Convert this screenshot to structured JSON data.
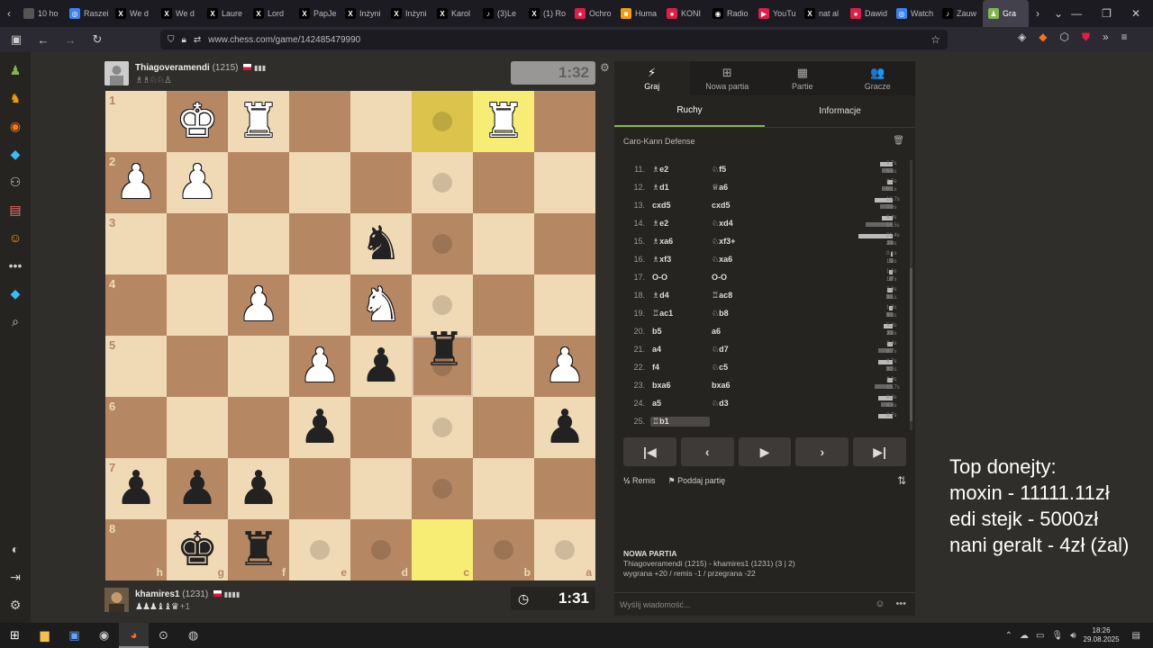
{
  "browser": {
    "tabs": [
      {
        "label": "10 ho",
        "fav": "",
        "color": "#555"
      },
      {
        "label": "Raszei",
        "fav": "◎",
        "color": "#3b82f6"
      },
      {
        "label": "We d",
        "fav": "X",
        "color": "#000"
      },
      {
        "label": "We d",
        "fav": "X",
        "color": "#000"
      },
      {
        "label": "Laure",
        "fav": "X",
        "color": "#000"
      },
      {
        "label": "Lord",
        "fav": "X",
        "color": "#000"
      },
      {
        "label": "PapJe",
        "fav": "X",
        "color": "#000"
      },
      {
        "label": "Inżyni",
        "fav": "X",
        "color": "#000"
      },
      {
        "label": "Inżyni",
        "fav": "X",
        "color": "#000"
      },
      {
        "label": "Karol",
        "fav": "X",
        "color": "#000"
      },
      {
        "label": "(3)Le",
        "fav": "♪",
        "color": "#000"
      },
      {
        "label": "(1) Ro",
        "fav": "X",
        "color": "#000"
      },
      {
        "label": "Ochro",
        "fav": "●",
        "color": "#e11d48"
      },
      {
        "label": "Huma",
        "fav": "■",
        "color": "#f59e0b"
      },
      {
        "label": "KONI",
        "fav": "●",
        "color": "#e11d48"
      },
      {
        "label": "Radio",
        "fav": "◉",
        "color": "#000"
      },
      {
        "label": "YouTu",
        "fav": "▶",
        "color": "#e11d48"
      },
      {
        "label": "nat al",
        "fav": "X",
        "color": "#000"
      },
      {
        "label": "Dawid",
        "fav": "●",
        "color": "#e11d48"
      },
      {
        "label": "Watch",
        "fav": "◎",
        "color": "#3b82f6"
      },
      {
        "label": "Zauw",
        "fav": "♪",
        "color": "#000"
      },
      {
        "label": "Gra",
        "fav": "♟",
        "color": "#81b64c",
        "active": true
      }
    ],
    "url": "www.chess.com/game/142485479990"
  },
  "top_player": {
    "name": "Thiagoveramendi",
    "rating": "(1215)",
    "captured": "♗♗♘♘♙",
    "clock": "1:32"
  },
  "bottom_player": {
    "name": "khamires1",
    "rating": "(1231)",
    "captured": "♟♟♟♝♝♛",
    "extra": "+1",
    "clock": "1:31"
  },
  "panel": {
    "tabs": [
      {
        "label": "Graj",
        "icon": "⚡",
        "active": true
      },
      {
        "label": "Nowa partia",
        "icon": "⊞"
      },
      {
        "label": "Partie",
        "icon": "▦"
      },
      {
        "label": "Gracze",
        "icon": "👥"
      }
    ],
    "subtabs": [
      {
        "label": "Ruchy",
        "active": true
      },
      {
        "label": "Informacje"
      }
    ],
    "opening": "Caro-Kann Defense",
    "moves": [
      {
        "n": "11.",
        "w": "♗e2",
        "b": "♘f5",
        "tw": "6.7s",
        "tb": "5.6s",
        "bw": 14,
        "bb": 12
      },
      {
        "n": "12.",
        "w": "♗d1",
        "b": "♕a6",
        "tw": "2.5s",
        "tb": "6.1s",
        "bw": 6,
        "bb": 12
      },
      {
        "n": "13.",
        "w": "cxd5",
        "b": "cxd5",
        "tw": "10.7s",
        "tb": "7.0s",
        "bw": 20,
        "bb": 14
      },
      {
        "n": "14.",
        "w": "♗e2",
        "b": "♘xd4",
        "tw": "6.4s",
        "tb": "16.5s",
        "bw": 12,
        "bb": 30
      },
      {
        "n": "15.",
        "w": "♗xa6",
        "b": "♘xf3+",
        "tw": "21.4s",
        "tb": "2.4s",
        "bw": 38,
        "bb": 6
      },
      {
        "n": "16.",
        "w": "♗xf3",
        "b": "♘xa6",
        "tw": "0.1s",
        "tb": "1.3s",
        "bw": 2,
        "bb": 4
      },
      {
        "n": "17.",
        "w": "O-O",
        "b": "O-O",
        "tw": "1.6s",
        "tb": "1.7s",
        "bw": 4,
        "bb": 4
      },
      {
        "n": "18.",
        "w": "♗d4",
        "b": "♖ac8",
        "tw": "2.9s",
        "tb": "3.1s",
        "bw": 6,
        "bb": 7
      },
      {
        "n": "19.",
        "w": "♖ac1",
        "b": "♘b8",
        "tw": "1.3s",
        "tb": "3.3s",
        "bw": 4,
        "bb": 7
      },
      {
        "n": "20.",
        "w": "b5",
        "b": "a6",
        "tw": "5.3s",
        "tb": "2.3s",
        "bw": 10,
        "bb": 6
      },
      {
        "n": "21.",
        "w": "a4",
        "b": "♘d7",
        "tw": "2.4s",
        "tb": "8.7s",
        "bw": 6,
        "bb": 16
      },
      {
        "n": "22.",
        "w": "f4",
        "b": "♘c5",
        "tw": "8.7s",
        "tb": "3.2s",
        "bw": 16,
        "bb": 7
      },
      {
        "n": "23.",
        "w": "bxa6",
        "b": "bxa6",
        "tw": "2.9s",
        "tb": "10.7s",
        "bw": 6,
        "bb": 20
      },
      {
        "n": "24.",
        "w": "a5",
        "b": "♘d3",
        "tw": "8.3s",
        "tb": "6.8s",
        "bw": 16,
        "bb": 13
      },
      {
        "n": "25.",
        "w": "♖b1",
        "b": "",
        "tw": "8.7s",
        "tb": "",
        "bw": 16,
        "bb": 0,
        "current": true
      }
    ],
    "actions": {
      "draw": "Remis",
      "resign": "Poddaj partię"
    },
    "game_info": {
      "title": "NOWA PARTIA",
      "players": "Thiagoveramendi (1215) - khamires1 (1231) (3 | 2)",
      "result": "wygrana +20 / remis -1 / przegrana -22"
    },
    "chat_placeholder": "Wyślij wiadomość..."
  },
  "donors": {
    "title": "Top donejty:",
    "lines": [
      "moxin - 11111.11zł",
      "edi stejk - 5000zł",
      "nani geralt - 4zł (żal)"
    ]
  },
  "taskbar": {
    "time": "18:26",
    "date": "29.08.2025"
  },
  "board": {
    "orientation": "black-bottom",
    "files": [
      "h",
      "g",
      "f",
      "e",
      "d",
      "c",
      "b",
      "a"
    ],
    "ranks": [
      "1",
      "2",
      "3",
      "4",
      "5",
      "6",
      "7",
      "8"
    ],
    "pieces": [
      {
        "r": 0,
        "c": 1,
        "p": "♚",
        "side": "w"
      },
      {
        "r": 0,
        "c": 2,
        "p": "♜",
        "side": "w"
      },
      {
        "r": 0,
        "c": 6,
        "p": "♜",
        "side": "w"
      },
      {
        "r": 1,
        "c": 0,
        "p": "♟",
        "side": "w"
      },
      {
        "r": 1,
        "c": 1,
        "p": "♟",
        "side": "w"
      },
      {
        "r": 2,
        "c": 4,
        "p": "♞",
        "side": "b"
      },
      {
        "r": 3,
        "c": 2,
        "p": "♟",
        "side": "w"
      },
      {
        "r": 3,
        "c": 4,
        "p": "♞",
        "side": "w"
      },
      {
        "r": 4,
        "c": 3,
        "p": "♟",
        "side": "w"
      },
      {
        "r": 4,
        "c": 4,
        "p": "♟",
        "side": "b"
      },
      {
        "r": 4,
        "c": 7,
        "p": "♟",
        "side": "w"
      },
      {
        "r": 5,
        "c": 3,
        "p": "♟",
        "side": "b"
      },
      {
        "r": 5,
        "c": 7,
        "p": "♟",
        "side": "b"
      },
      {
        "r": 6,
        "c": 0,
        "p": "♟",
        "side": "b"
      },
      {
        "r": 6,
        "c": 1,
        "p": "♟",
        "side": "b"
      },
      {
        "r": 6,
        "c": 2,
        "p": "♟",
        "side": "b"
      },
      {
        "r": 7,
        "c": 1,
        "p": "♚",
        "side": "b"
      },
      {
        "r": 7,
        "c": 2,
        "p": "♜",
        "side": "b"
      }
    ],
    "highlights": [
      {
        "r": 0,
        "c": 5,
        "dark": true
      },
      {
        "r": 0,
        "c": 6
      },
      {
        "r": 7,
        "c": 5
      }
    ],
    "dots": [
      [
        0,
        5
      ],
      [
        1,
        5
      ],
      [
        2,
        5
      ],
      [
        3,
        5
      ],
      [
        4,
        5
      ],
      [
        5,
        5
      ],
      [
        6,
        5
      ],
      [
        7,
        3
      ],
      [
        7,
        4
      ],
      [
        7,
        6
      ],
      [
        7,
        7
      ]
    ],
    "drag_origin": [
      4,
      5
    ],
    "dragged_piece": "♜"
  }
}
